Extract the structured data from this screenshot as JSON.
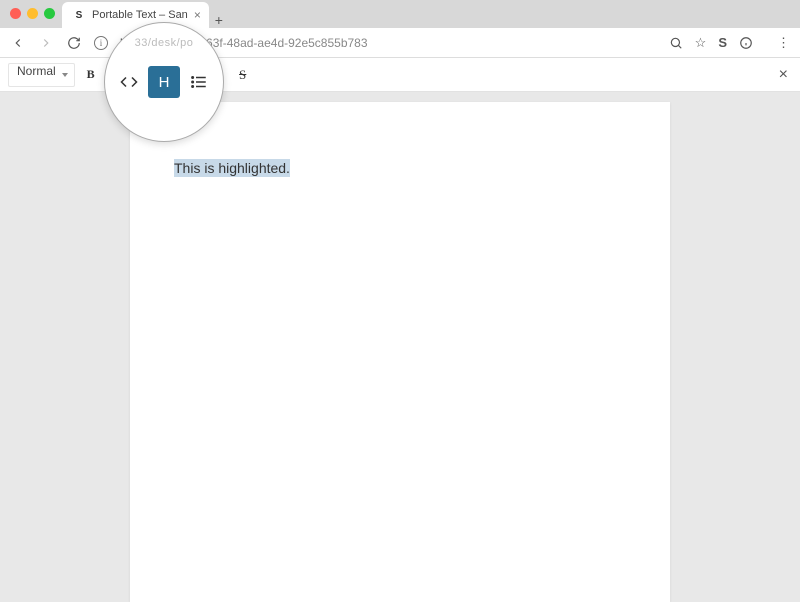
{
  "browser": {
    "tab_title": "Portable Text – San",
    "tab_favicon_letter": "S",
    "url_host": "localh",
    "url_path_visible": "c1c38-363f-48ad-ae4d-92e5c855b783"
  },
  "toolbar": {
    "style_label": "Normal",
    "bold_label": "B",
    "strike_label": "S",
    "highlight_label": "H",
    "code_tooltip": "code",
    "list_tooltip": "list"
  },
  "magnifier": {
    "top_text": "33/desk/po",
    "highlight_btn": "H"
  },
  "content": {
    "highlighted_text": "This is highlighted."
  },
  "colors": {
    "highlight_bg": "#c7d9e8",
    "highlight_btn_bg": "#2a6f97"
  }
}
